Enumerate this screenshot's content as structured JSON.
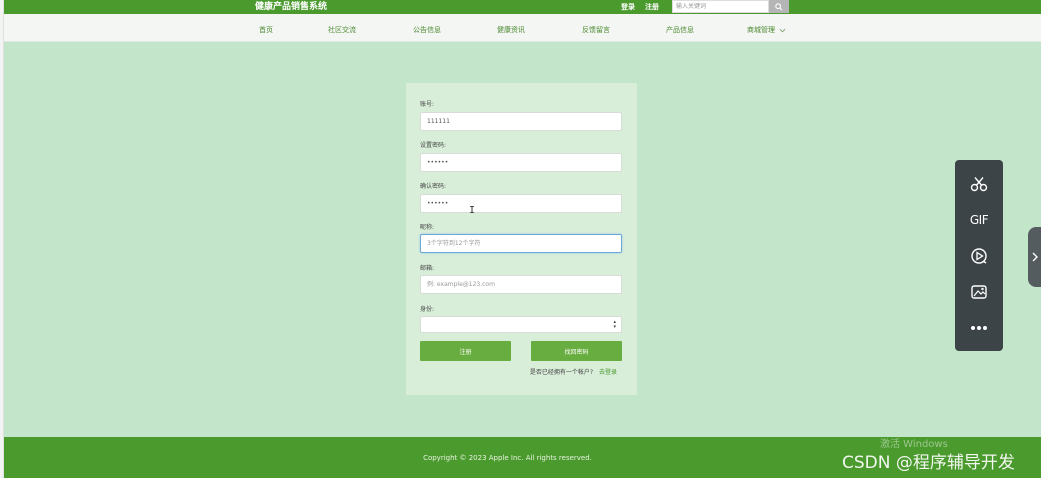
{
  "header": {
    "site_title": "健康产品销售系统",
    "login_label": "登录",
    "register_label": "注册",
    "search_placeholder": "输入关键词"
  },
  "nav": {
    "items": [
      "首页",
      "社区交流",
      "公告信息",
      "健康资讯",
      "反馈留言",
      "产品信息",
      "商城管理"
    ]
  },
  "form": {
    "account_label": "账号:",
    "account_value": "111111",
    "password_label": "设置密码:",
    "password_value": "••••••",
    "confirm_label": "确认密码:",
    "confirm_value": "••••••",
    "nickname_label": "昵称:",
    "nickname_placeholder": "3个字符到12个字符",
    "email_label": "邮箱:",
    "email_placeholder": "例: example@123.com",
    "identity_label": "身份:",
    "identity_value": "",
    "register_button": "注册",
    "retrieve_button": "找回密码",
    "login_question": "是否已经拥有一个帐户?",
    "login_link": "去登录"
  },
  "footer": {
    "copyright": "Copyright © 2023 Apple Inc. All rights reserved."
  },
  "watermarks": {
    "activate_windows": "激活 Windows",
    "csdn": "CSDN @程序辅导开发"
  },
  "float_toolbar": {
    "gif_label": "GIF",
    "icons": [
      "scissors-icon",
      "gif-icon",
      "screen-record-icon",
      "image-capture-icon",
      "more-icon"
    ]
  },
  "colors": {
    "header_green": "#4a9a2e",
    "page_bg": "#c3e6cb",
    "card_bg": "#d8eed9",
    "button_green": "#68ad3f",
    "toolbar_dark": "#3d4447"
  }
}
